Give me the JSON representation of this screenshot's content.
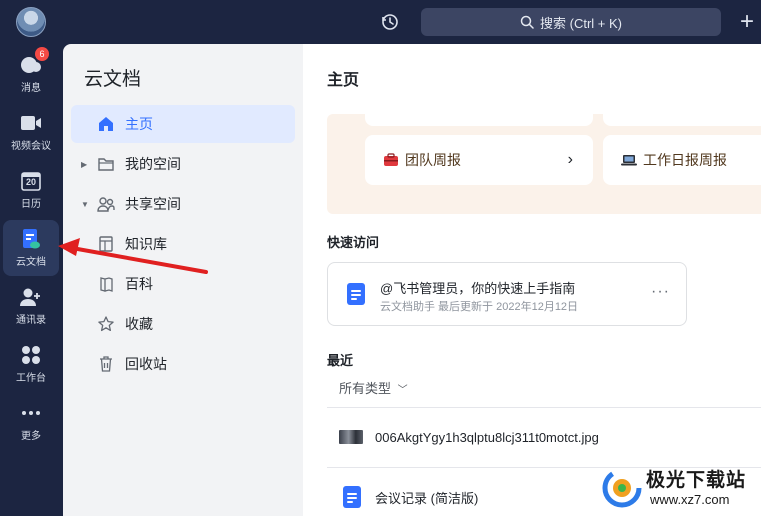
{
  "topbar": {
    "search_placeholder": "搜索 (Ctrl + K)",
    "plus": "+"
  },
  "rail": {
    "items": [
      {
        "label": "消息",
        "badge": "6"
      },
      {
        "label": "视频会议"
      },
      {
        "label": "日历",
        "day": "20"
      },
      {
        "label": "云文档"
      },
      {
        "label": "通讯录"
      },
      {
        "label": "工作台"
      },
      {
        "label": "更多"
      }
    ]
  },
  "sidebar": {
    "title": "云文档",
    "items": [
      {
        "label": "主页"
      },
      {
        "label": "我的空间"
      },
      {
        "label": "共享空间"
      },
      {
        "label": "知识库"
      },
      {
        "label": "百科"
      },
      {
        "label": "收藏"
      },
      {
        "label": "回收站"
      }
    ]
  },
  "main": {
    "title": "主页",
    "banner": {
      "cards": [
        {
          "label": "团队周报",
          "chevron": "›"
        },
        {
          "label": "工作日报周报"
        }
      ]
    },
    "quick_access": {
      "title": "快速访问",
      "card": {
        "name": "@飞书管理员，你的快速上手指南",
        "meta": "云文档助手 最后更新于 2022年12月12日",
        "more": "···"
      }
    },
    "recent": {
      "title": "最近",
      "filter": "所有类型",
      "files": [
        {
          "name": "006AkgtYgy1h3qlptu8lcj311t0motct.jpg",
          "type": "image"
        },
        {
          "name": "会议记录 (简洁版)",
          "type": "doc"
        }
      ]
    }
  },
  "watermark": {
    "text": "极光下载站",
    "url": "www.xz7.com"
  },
  "colors": {
    "rail_bg": "#1c2541",
    "accent": "#3370ff",
    "active_bg": "#e1eaff",
    "badge": "#f54a45",
    "banner_bg": "#fbf2ea",
    "annotation": "#e02020"
  }
}
